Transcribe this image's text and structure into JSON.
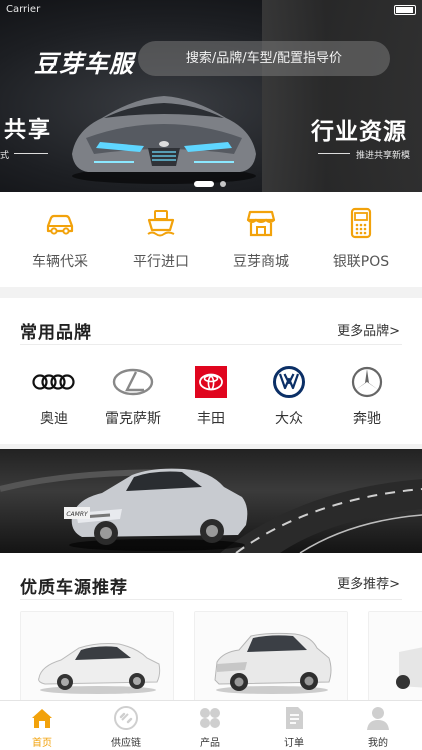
{
  "status_bar": {
    "carrier": "Carrier"
  },
  "header": {
    "logo_text": "豆芽车服",
    "search_placeholder": "搜索/品牌/车型/配置指导价"
  },
  "hero": {
    "left_title": "共享",
    "left_subtitle": "式",
    "right_title": "行业资源",
    "right_subtitle": "推进共享新模",
    "slide_count": 2,
    "active_slide": 1
  },
  "quick_menu": [
    {
      "label": "车辆代采",
      "icon": "car-icon"
    },
    {
      "label": "平行进口",
      "icon": "ship-icon"
    },
    {
      "label": "豆芽商城",
      "icon": "store-icon"
    },
    {
      "label": "银联POS",
      "icon": "pos-terminal-icon"
    }
  ],
  "brands": {
    "title": "常用品牌",
    "more": "更多品牌>",
    "items": [
      {
        "label": "奥迪",
        "icon": "audi-logo-icon"
      },
      {
        "label": "雷克萨斯",
        "icon": "lexus-logo-icon"
      },
      {
        "label": "丰田",
        "icon": "toyota-logo-icon"
      },
      {
        "label": "大众",
        "icon": "volkswagen-logo-icon"
      },
      {
        "label": "奔驰",
        "icon": "mercedes-logo-icon"
      }
    ]
  },
  "promo": {
    "badge": "CAMRY"
  },
  "recommend": {
    "title": "优质车源推荐",
    "more": "更多推荐>"
  },
  "tabbar": [
    {
      "label": "首页",
      "icon": "home-icon",
      "active": true
    },
    {
      "label": "供应链",
      "icon": "link-icon",
      "active": false
    },
    {
      "label": "产品",
      "icon": "grid-icon",
      "active": false
    },
    {
      "label": "订单",
      "icon": "document-icon",
      "active": false
    },
    {
      "label": "我的",
      "icon": "user-icon",
      "active": false
    }
  ],
  "colors": {
    "accent": "#f2a20b",
    "icon_gray": "#cfcfcf",
    "text_dark": "#222222"
  }
}
